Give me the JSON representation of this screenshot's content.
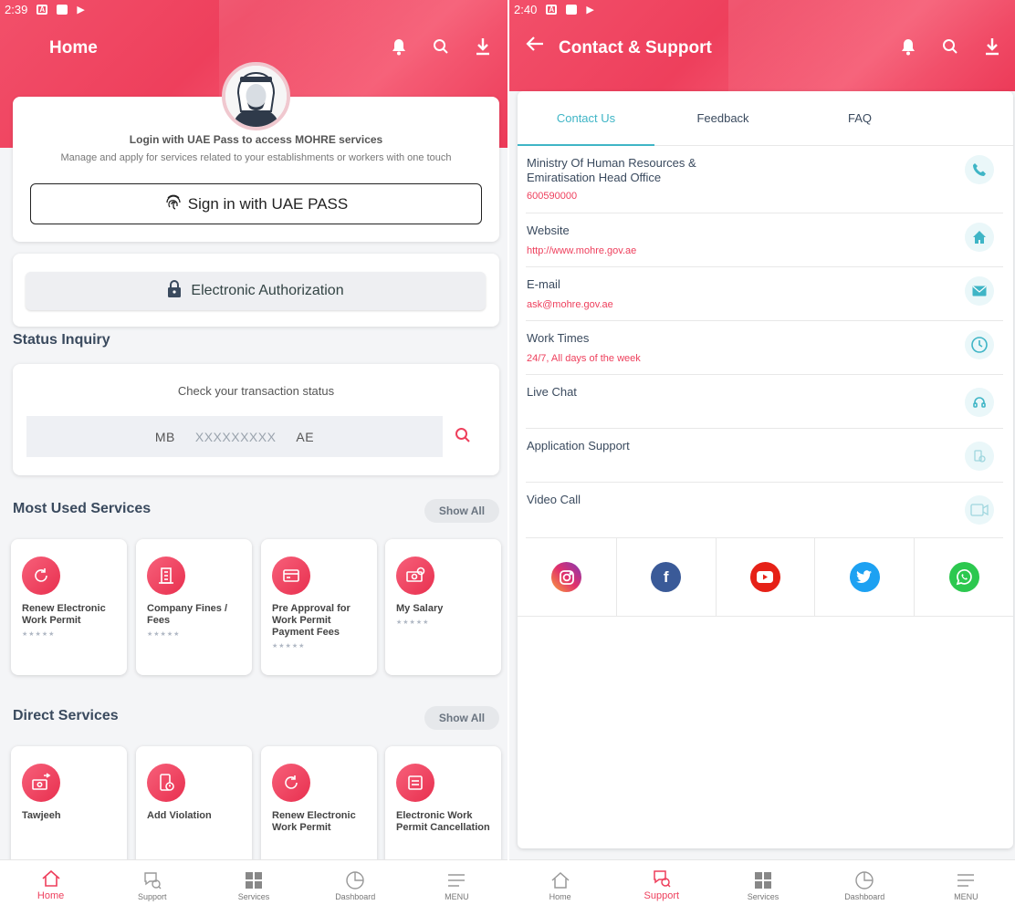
{
  "left": {
    "statusbar": {
      "time": "2:39"
    },
    "appbar": {
      "title": "Home"
    },
    "login": {
      "title": "Login with UAE Pass to access MOHRE services",
      "description": "Manage and apply for services related to your establishments or workers with one touch",
      "button_label": "Sign in with UAE PASS"
    },
    "auth": {
      "label": "Electronic Authorization"
    },
    "status": {
      "section_title": "Status Inquiry",
      "check_label": "Check your transaction status",
      "prefix": "MB",
      "placeholder": "XXXXXXXXX",
      "suffix": "AE"
    },
    "most_used": {
      "title": "Most Used Services",
      "show_all": "Show All",
      "items": [
        {
          "name": "Renew Electronic Work Permit",
          "icon": "refresh-document-icon"
        },
        {
          "name": "Company Fines / Fees",
          "icon": "building-fines-icon"
        },
        {
          "name": "Pre Approval for Work Permit Payment Fees",
          "icon": "payment-card-icon"
        },
        {
          "name": "My Salary",
          "icon": "salary-money-icon"
        }
      ]
    },
    "direct": {
      "title": "Direct Services",
      "show_all": "Show All",
      "items": [
        {
          "name": "Tawjeeh",
          "icon": "money-transfer-icon"
        },
        {
          "name": "Add Violation",
          "icon": "violation-phone-icon"
        },
        {
          "name": "Renew Electronic Work Permit",
          "icon": "refresh-document-icon"
        },
        {
          "name": "Electronic Work Permit Cancellation",
          "icon": "cancel-document-icon"
        }
      ]
    },
    "nav": [
      {
        "label": "Home",
        "icon": "home-icon",
        "active": true
      },
      {
        "label": "Support",
        "icon": "support-icon"
      },
      {
        "label": "Services",
        "icon": "grid-icon"
      },
      {
        "label": "Dashboard",
        "icon": "pie-chart-icon"
      },
      {
        "label": "MENU",
        "icon": "menu-icon"
      }
    ]
  },
  "right": {
    "statusbar": {
      "time": "2:40"
    },
    "appbar": {
      "title": "Contact & Support"
    },
    "tabs": [
      "Contact Us",
      "Feedback",
      "FAQ"
    ],
    "contacts": [
      {
        "label": "Ministry Of Human Resources & Emiratisation Head Office",
        "value": "600590000",
        "icon": "phone-icon"
      },
      {
        "label": "Website",
        "value": "http://www.mohre.gov.ae",
        "icon": "home-icon"
      },
      {
        "label": "E-mail",
        "value": "ask@mohre.gov.ae",
        "icon": "mail-icon"
      },
      {
        "label": "Work Times",
        "value": "24/7, All days of the week",
        "icon": "clock-icon"
      },
      {
        "label": "Live Chat",
        "value": "",
        "icon": "headset-icon"
      },
      {
        "label": "Application Support",
        "value": "",
        "icon": "app-support-icon"
      },
      {
        "label": "Video Call",
        "value": "",
        "icon": "video-call-icon"
      }
    ],
    "socials": [
      "instagram",
      "facebook",
      "youtube",
      "twitter",
      "whatsapp"
    ],
    "nav": [
      {
        "label": "Home",
        "icon": "home-icon"
      },
      {
        "label": "Support",
        "icon": "support-icon",
        "active": true
      },
      {
        "label": "Services",
        "icon": "grid-icon"
      },
      {
        "label": "Dashboard",
        "icon": "pie-chart-icon"
      },
      {
        "label": "MENU",
        "icon": "menu-icon"
      }
    ]
  },
  "colors": {
    "brand": "#ee3f5c",
    "teal": "#3fb5c6",
    "text": "#3a4a5e"
  }
}
